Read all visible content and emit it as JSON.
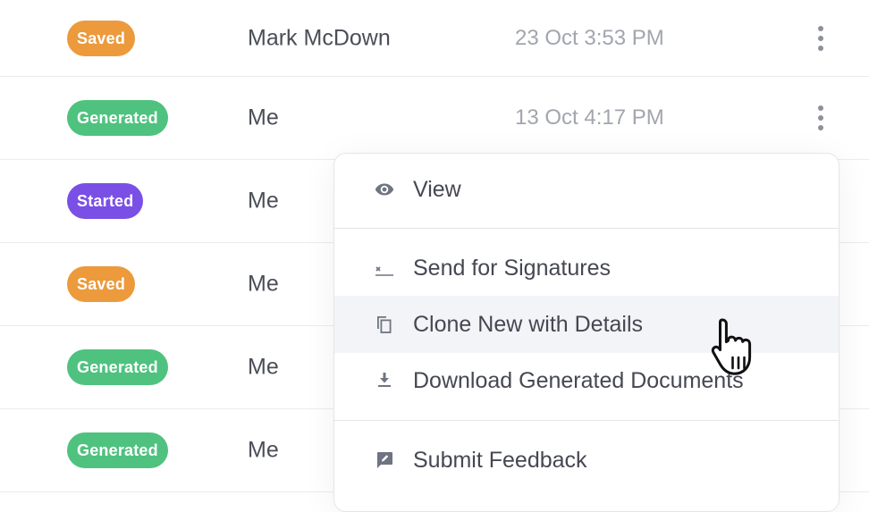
{
  "rows": [
    {
      "status": "Saved",
      "name": "Mark McDown",
      "date": "23 Oct 3:53 PM"
    },
    {
      "status": "Generated",
      "name": "Me",
      "date": "13 Oct 4:17 PM"
    },
    {
      "status": "Started",
      "name": "Me",
      "date": ""
    },
    {
      "status": "Saved",
      "name": "Me",
      "date": ""
    },
    {
      "status": "Generated",
      "name": "Me",
      "date": ""
    },
    {
      "status": "Generated",
      "name": "Me",
      "date": ""
    }
  ],
  "menu": {
    "view": {
      "label": "View",
      "icon": "eye-icon"
    },
    "send": {
      "label": "Send for Signatures",
      "icon": "signature-icon"
    },
    "clone": {
      "label": "Clone New with Details",
      "icon": "copy-icon"
    },
    "download": {
      "label": "Download Generated Documents",
      "icon": "download-icon"
    },
    "feedback": {
      "label": "Submit Feedback",
      "icon": "feedback-icon"
    }
  },
  "colors": {
    "saved": "#ec9a3c",
    "generated": "#4fc27f",
    "started": "#7a4fe6",
    "hover": "#f3f4f8"
  }
}
